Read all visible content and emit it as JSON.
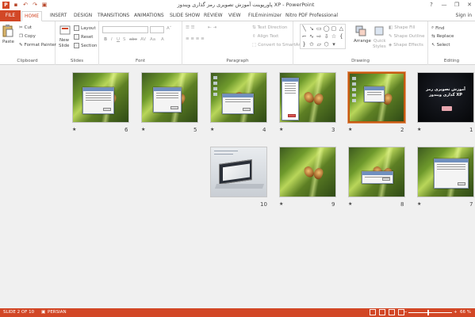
{
  "window": {
    "title": "پاورپوینت آموزش تصویری رمز گذاری ویندوز XP - PowerPoint",
    "signin": "Sign in",
    "help": "?",
    "minimize": "—",
    "restore": "❐",
    "close": "✕"
  },
  "tabs": [
    "FILE",
    "HOME",
    "INSERT",
    "DESIGN",
    "TRANSITIONS",
    "ANIMATIONS",
    "SLIDE SHOW",
    "REVIEW",
    "VIEW",
    "FILEminimizer",
    "Nitro PDF Professional"
  ],
  "active_tab": "HOME",
  "ribbon": {
    "clipboard": {
      "label": "Clipboard",
      "paste": "Paste",
      "cut": "Cut",
      "copy": "Copy",
      "format_painter": "Format Painter"
    },
    "slides": {
      "label": "Slides",
      "new_slide": "New",
      "new_slide2": "Slide",
      "layout": "Layout",
      "reset": "Reset",
      "section": "Section"
    },
    "font": {
      "label": "Font"
    },
    "paragraph": {
      "label": "Paragraph",
      "text_direction": "Text Direction",
      "align_text": "Align Text",
      "smartart": "Convert to SmartArt"
    },
    "drawing": {
      "label": "Drawing",
      "arrange": "Arrange",
      "quick_styles": "Quick",
      "quick_styles2": "Styles",
      "shape_fill": "Shape Fill",
      "shape_outline": "Shape Outline",
      "shape_effects": "Shape Effects"
    },
    "editing": {
      "label": "Editing",
      "find": "Find",
      "replace": "Replace",
      "select": "Select"
    }
  },
  "slides": [
    {
      "number": "1",
      "title": "آموزش تصویری رمز گذاری ویندوز XP",
      "selected": false
    },
    {
      "number": "2",
      "selected": true
    },
    {
      "number": "3",
      "selected": false
    },
    {
      "number": "4",
      "selected": false
    },
    {
      "number": "5",
      "selected": false
    },
    {
      "number": "6",
      "selected": false
    },
    {
      "number": "7",
      "selected": false
    },
    {
      "number": "8",
      "selected": false
    },
    {
      "number": "9",
      "selected": false
    },
    {
      "number": "10",
      "selected": false
    }
  ],
  "star_glyph": "★",
  "status": {
    "slide_info": "SLIDE 2 OF 10",
    "language": "PERSIAN",
    "zoom": "66 %"
  },
  "colors": {
    "accent": "#d24726",
    "selection": "#c55a11"
  }
}
